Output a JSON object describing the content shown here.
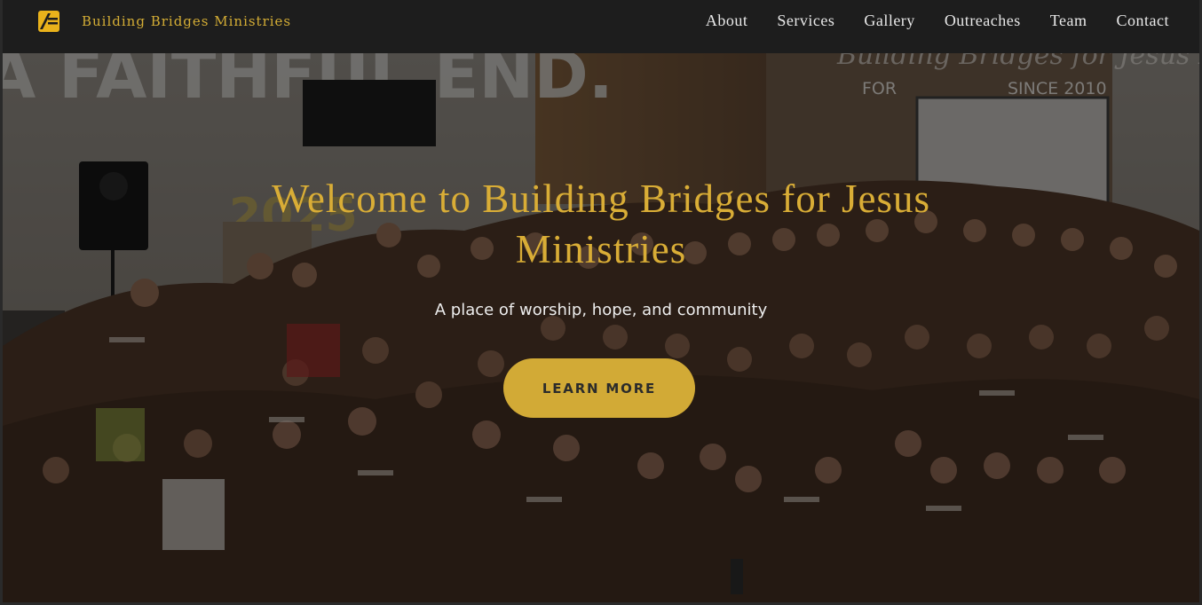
{
  "header": {
    "brand_name": "Building Bridges Ministries",
    "nav": [
      "About",
      "Services",
      "Gallery",
      "Outreaches",
      "Team",
      "Contact"
    ]
  },
  "hero": {
    "title": "Welcome to Building Bridges for Jesus Ministries",
    "subtitle": "A place of worship, hope, and community",
    "cta_label": "LEARN MORE",
    "background_text": {
      "banner": "A FAITHFUL END.",
      "for": "FOR",
      "since": "SINCE 2010",
      "script": "Building Bridges for Jesus Ministries",
      "year": "2025"
    }
  },
  "colors": {
    "accent": "#d4ad35",
    "header_bg": "#1d1d1d",
    "nav_text": "#e9e9e9",
    "shirt": "#4a3426"
  },
  "icons": {
    "logo": "bridge-logo-icon"
  }
}
